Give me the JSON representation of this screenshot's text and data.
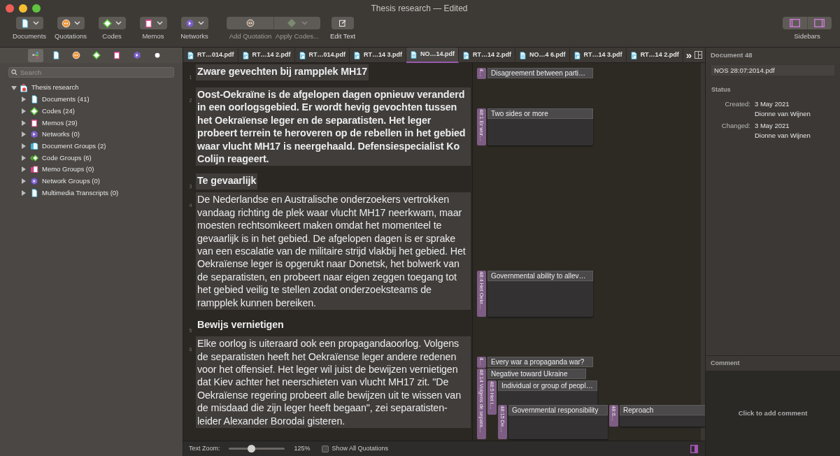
{
  "window": {
    "title": "Thesis research — Edited"
  },
  "toolbar": {
    "groups": [
      {
        "label": "Documents",
        "kind": "document"
      },
      {
        "label": "Quotations",
        "kind": "quotation"
      },
      {
        "label": "Codes",
        "kind": "code"
      },
      {
        "label": "Memos",
        "kind": "memo"
      },
      {
        "label": "Networks",
        "kind": "network"
      }
    ],
    "actions": [
      {
        "label": "Add Quotation",
        "kind": "quotation",
        "disabled": true
      },
      {
        "label": "Apply Codes...",
        "kind": "code",
        "disabled": true
      },
      {
        "label": "Edit Text",
        "kind": "edit",
        "disabled": false
      }
    ],
    "sidebars_label": "Sidebars"
  },
  "navigator": {
    "filters": [
      {
        "kind": "all",
        "selected": true
      },
      {
        "kind": "document",
        "selected": false
      },
      {
        "kind": "quotation",
        "selected": false
      },
      {
        "kind": "code",
        "selected": false
      },
      {
        "kind": "memo",
        "selected": false
      },
      {
        "kind": "network",
        "selected": false
      },
      {
        "kind": "dot",
        "selected": false
      }
    ],
    "search": {
      "placeholder": "Search"
    },
    "tree": {
      "label": "Thesis research",
      "kind": "project",
      "expanded": true,
      "children": [
        {
          "label": "Documents (41)",
          "kind": "document",
          "expanded": false
        },
        {
          "label": "Codes (24)",
          "kind": "code",
          "expanded": false
        },
        {
          "label": "Memos (29)",
          "kind": "memo",
          "expanded": false
        },
        {
          "label": "Networks (0)",
          "kind": "network",
          "expanded": false
        },
        {
          "label": "Document Groups (2)",
          "kind": "document-group",
          "expanded": false
        },
        {
          "label": "Code Groups (6)",
          "kind": "code-group",
          "expanded": false
        },
        {
          "label": "Memo Groups (0)",
          "kind": "memo-group",
          "expanded": false
        },
        {
          "label": "Network Groups (0)",
          "kind": "network-group",
          "expanded": false
        },
        {
          "label": "Multimedia Transcripts (0)",
          "kind": "document",
          "expanded": false
        }
      ]
    }
  },
  "tabs": [
    {
      "label": "RT…014.pdf",
      "kind": "pdf",
      "selected": false
    },
    {
      "label": "RT…14 2.pdf",
      "kind": "pdf",
      "selected": false
    },
    {
      "label": "RT…014.pdf",
      "kind": "pdf",
      "selected": false
    },
    {
      "label": "RT…14 3.pdf",
      "kind": "pdf",
      "selected": false
    },
    {
      "label": "NO…14.pdf",
      "kind": "text",
      "selected": true
    },
    {
      "label": "RT…14 2.pdf",
      "kind": "pdf",
      "selected": false
    },
    {
      "label": "NO…4 6.pdf",
      "kind": "text",
      "selected": false
    },
    {
      "label": "RT…14 3.pdf",
      "kind": "pdf",
      "selected": false
    },
    {
      "label": "RT…14 2.pdf",
      "kind": "pdf",
      "selected": false
    }
  ],
  "tabs_overflow": "»",
  "document": {
    "paragraphs": [
      {
        "number": "1",
        "kind": "heading",
        "highlighted": true,
        "text": "Zware gevechten bij rampplek MH17"
      },
      {
        "number": "2",
        "kind": "lead",
        "highlighted": true,
        "text": "Oost-Oekraïne is de afgelopen dagen opnieuw veranderd in een oorlogsgebied. Er wordt hevig gevochten tussen het Oekraïense leger en de separatisten. Het leger probeert terrein te heroveren op de rebellen in het gebied waar vlucht MH17 is neergehaald. Defensiespecialist Ko Colijn reageert."
      },
      {
        "number": "3",
        "kind": "heading",
        "highlighted": true,
        "text": "Te gevaarlijk"
      },
      {
        "number": "4",
        "kind": "body",
        "highlighted": true,
        "text": "De Nederlandse en Australische onderzoekers vertrokken vandaag richting de plek waar vlucht MH17 neerkwam, maar moesten rechtsomkeert maken omdat het momenteel te gevaarlijk is in het gebied. De afgelopen dagen is er sprake van een escalatie van de militaire strijd vlakbij het gebied. Het Oekraïense leger is opgerukt naar Donetsk, het bolwerk van de separatisten, en probeert naar eigen zeggen toegang tot het gebied veilig te stellen zodat onderzoeksteams de rampplek kunnen bereiken."
      },
      {
        "number": "5",
        "kind": "heading",
        "highlighted": false,
        "text": "Bewijs vernietigen"
      },
      {
        "number": "6",
        "kind": "body",
        "highlighted": true,
        "text": "Elke oorlog is uiteraard ook een propagandaoorlog. Volgens de separatisten heeft het Oekraïense leger andere redenen voor het offensief. Het leger wil juist de bewijzen vernietigen dat Kiev achter het neerschieten van vlucht MH17 zit. \"De Oekraïense regering probeert alle bewijzen uit te wissen van de misdaad die zijn leger heeft begaan\", zei separatisten-leider Alexander Borodai gisteren."
      }
    ]
  },
  "margin": {
    "quotations": [
      {
        "tag": "4…",
        "code": "Disagreement between parti…"
      },
      {
        "tag": "48:1 Er wor…",
        "code": "Two sides or more"
      },
      {
        "tag": "48:4 Het Oekr…",
        "code": "Governmental ability to allev…"
      },
      {
        "tag": "4…",
        "code": "Every war a propaganda war?"
      },
      {
        "tag": "48:14 Volgens de separa…",
        "code": "Negative toward Ukraine"
      },
      {
        "tag": "48:5 Het I…",
        "code": "Individual or group of peopl…"
      },
      {
        "tag": "48:15 De…",
        "code": "Governmental responsibility"
      },
      {
        "tag": "48:6…",
        "code": "Reproach"
      }
    ]
  },
  "bottom_bar": {
    "zoom_label": "Text Zoom:",
    "zoom": {
      "level": 0.4
    },
    "zoom_value": "125%",
    "show_all": {
      "label": "Show All Quotations",
      "checked": false
    }
  },
  "inspector": {
    "title": "Document 48",
    "name": "NOS 28:07:2014.pdf",
    "status_heading": "Status",
    "fields": [
      {
        "label": "Created:",
        "date": "3 May 2021",
        "user": "Dionne van Wijnen"
      },
      {
        "label": "Changed:",
        "date": "3 May 2021",
        "user": "Dionne van Wijnen"
      }
    ],
    "comment_heading": "Comment",
    "comment_prompt": "Click to add comment"
  }
}
